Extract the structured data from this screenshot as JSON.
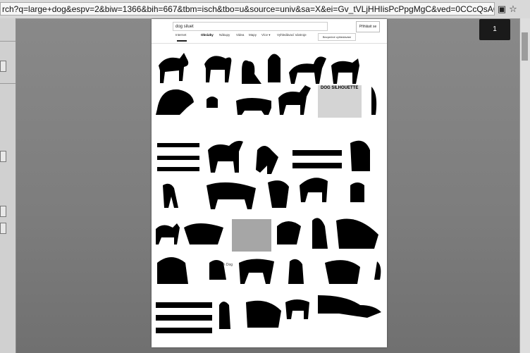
{
  "browser": {
    "url": "rch?q=large+dog&espv=2&biw=1366&bih=667&tbm=isch&tbo=u&source=univ&sa=X&ei=Gv_tVLjHHIisPcPpgMgC&ved=0CCcQsAQ#tbr",
    "extension_badge_icon": "extension-icon",
    "star_icon": "star-icon",
    "tooltip_text": "1"
  },
  "google": {
    "search_query": "dog siluet",
    "search_button_label": "Přihlásit se",
    "tabs": [
      "Internet",
      "Obrázky",
      "Nákupy",
      "Videa",
      "Mapy",
      "Více ▾",
      "Vyhledávací nástroje"
    ],
    "active_tab": "Obrázky",
    "safe_search_label": "Bezpečné vyhledávání",
    "thumbnail_title": "DOG SILHOUETTE",
    "caption": "Canaan Dog"
  }
}
